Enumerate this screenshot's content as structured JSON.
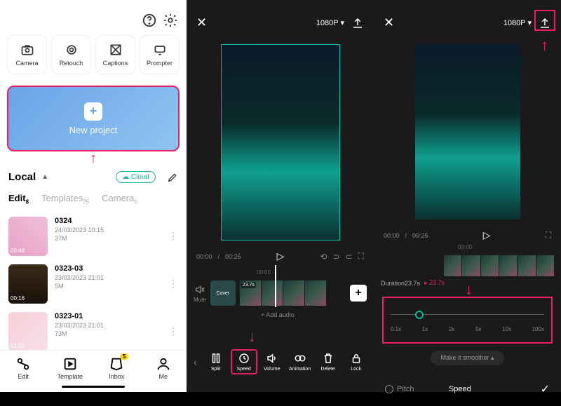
{
  "p1": {
    "tools": [
      {
        "label": "Camera"
      },
      {
        "label": "Retouch"
      },
      {
        "label": "Captions"
      },
      {
        "label": "Prompter"
      }
    ],
    "new_project": "New project",
    "local": "Local",
    "cloud": "Cloud",
    "tabs": {
      "edit": "Edit",
      "edit_n": "8",
      "templates": "Templates",
      "templates_n": "25",
      "camera": "Camera",
      "camera_n": "0"
    },
    "projects": [
      {
        "name": "0324",
        "date": "24/03/2023 10:15",
        "size": "37M",
        "dur": "00:48"
      },
      {
        "name": "0323-03",
        "date": "23/03/2023 21:01",
        "size": "5M",
        "dur": "00:16"
      },
      {
        "name": "0323-01",
        "date": "23/03/2023 21:01",
        "size": "73M",
        "dur": "01:01"
      }
    ],
    "nav": {
      "edit": "Edit",
      "template": "Template",
      "inbox": "Inbox",
      "inbox_badge": "5",
      "me": "Me"
    }
  },
  "p2": {
    "resolution": "1080P",
    "time_cur": "00:00",
    "time_tot": "00:26",
    "ruler": "00:00",
    "clip_dur": "23.7s",
    "cover": "Cover",
    "mute": "Mute",
    "add_audio": "+  Add audio",
    "tools": {
      "split": "Split",
      "speed": "Speed",
      "volume": "Volume",
      "animation": "Animation",
      "delete": "Delete",
      "lock": "Lock"
    }
  },
  "p3": {
    "resolution": "1080P",
    "time_cur": "00:00",
    "time_tot": "00:26",
    "ruler": "00:00",
    "duration_lbl": "Duration23.7s",
    "duration_arrow": "▸",
    "duration_new": "23.7s",
    "speeds": [
      "0.1x",
      "1x",
      "2x",
      "5x",
      "10x",
      "100x"
    ],
    "smoother": "Make it smoother",
    "pitch": "Pitch",
    "speed": "Speed"
  }
}
